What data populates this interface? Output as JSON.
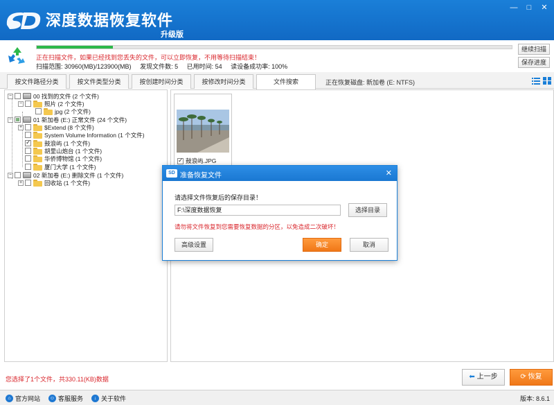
{
  "app": {
    "title": "深度数据恢复软件",
    "edition": "升级版",
    "logo_text": "SD",
    "window_controls": {
      "minimize": "—",
      "restore": "□",
      "close": "✕"
    }
  },
  "scan": {
    "progress": 0.16,
    "warning": "正在扫描文件，如果已经找到您丢失的文件，可以立即恢复，不用等待扫描结束！",
    "stats": {
      "range": "扫描范围: 30960(MB)/123900(MB)",
      "found": "发现文件数: 5",
      "elapsed": "已用时间: 54",
      "read_rate": "读设备成功率: 100%"
    },
    "buttons": {
      "continue": "继续扫描",
      "save_progress": "保存进度"
    }
  },
  "tabs": [
    "按文件路径分类",
    "按文件类型分类",
    "按创建时间分类",
    "按修改时间分类",
    "文件搜索"
  ],
  "active_tab": 4,
  "current_disk": "正在恢复磁盘: 新加卷 (E: NTFS)",
  "tree": [
    {
      "label": "00 找到的文件  (2 个文件)"
    },
    {
      "label": "照片    (2 个文件)"
    },
    {
      "label": "jpg    (2 个文件)"
    },
    {
      "label": "01 新加卷 (E:) 正常文件  (24 个文件)"
    },
    {
      "label": "$Extend    (8 个文件)"
    },
    {
      "label": "System Volume Information    (1 个文件)"
    },
    {
      "label": "鼓浪屿    (1 个文件)"
    },
    {
      "label": "胡里山炮台    (1 个文件)"
    },
    {
      "label": "华侨博物馆    (1 个文件)"
    },
    {
      "label": "厦门大学    (1 个文件)"
    },
    {
      "label": "02 新加卷 (E:) 删除文件  (1 个文件)"
    },
    {
      "label": "回收站    (1 个文件)"
    }
  ],
  "file": {
    "name": "鼓浪屿.JPG"
  },
  "status": "您选择了1个文件，共330.11(KB)数据",
  "nav": {
    "prev": "上一步",
    "recover": "恢复"
  },
  "footer": {
    "website": "官方网站",
    "support": "客服服务",
    "about": "关于软件",
    "version": "版本: 8.6.1"
  },
  "dialog": {
    "title": "准备恢复文件",
    "prompt": "请选择文件恢复后的保存目录！",
    "path": "F:\\深度数据恢复",
    "choose_dir": "选择目录",
    "warning": "请勿将文件恢复到您需要恢复数据的分区，以免造成二次破坏！",
    "advanced": "高级设置",
    "ok": "确定",
    "cancel": "取消",
    "close": "✕"
  },
  "colors": {
    "brand_blue": "#1a7fd8",
    "accent_orange": "#f07818",
    "warning_red": "#d9262c",
    "progress_green": "#2db84a"
  }
}
